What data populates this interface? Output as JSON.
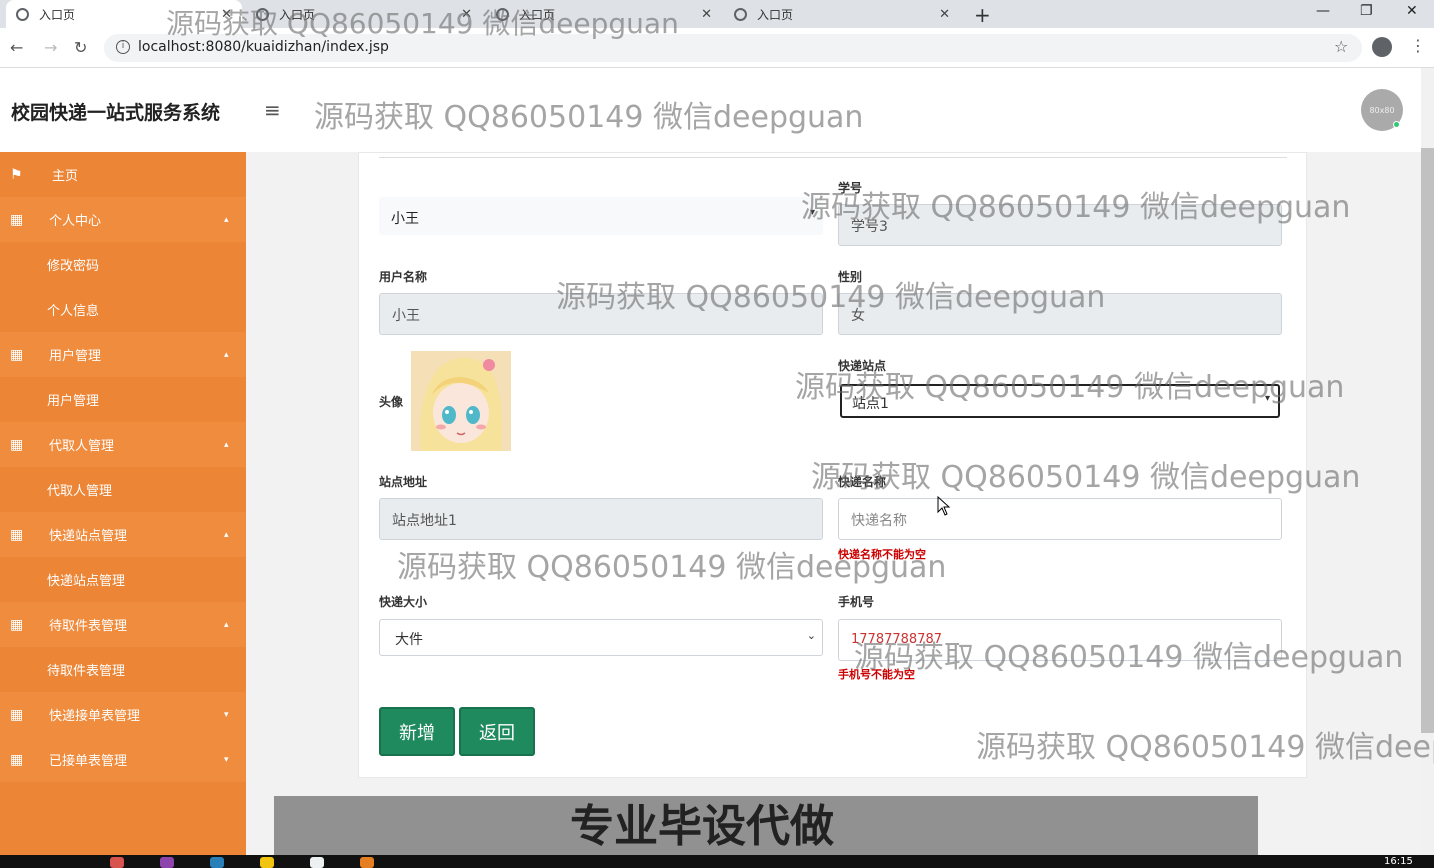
{
  "browser": {
    "tabs": [
      {
        "title": "入口页",
        "active": true
      },
      {
        "title": "入口页",
        "active": false
      },
      {
        "title": "入口页",
        "active": false
      },
      {
        "title": "入口页",
        "active": false
      }
    ],
    "url": "localhost:8080/kuaidizhan/index.jsp"
  },
  "header": {
    "title": "校园快递一站式服务系统",
    "avatar_text": "80x80"
  },
  "sidebar": {
    "items": [
      {
        "label": "主页",
        "type": "root",
        "icon": "flag-icon"
      },
      {
        "label": "个人中心",
        "type": "parent",
        "icon": "grid-icon",
        "caret": "up"
      },
      {
        "label": "修改密码",
        "type": "child"
      },
      {
        "label": "个人信息",
        "type": "child"
      },
      {
        "label": "用户管理",
        "type": "parent",
        "icon": "grid-icon",
        "caret": "up"
      },
      {
        "label": "用户管理",
        "type": "child"
      },
      {
        "label": "代取人管理",
        "type": "parent",
        "icon": "grid-icon",
        "caret": "up"
      },
      {
        "label": "代取人管理",
        "type": "child"
      },
      {
        "label": "快递站点管理",
        "type": "parent",
        "icon": "grid-icon",
        "caret": "up"
      },
      {
        "label": "快递站点管理",
        "type": "child"
      },
      {
        "label": "待取件表管理",
        "type": "parent",
        "icon": "grid-icon",
        "caret": "up"
      },
      {
        "label": "待取件表管理",
        "type": "child"
      },
      {
        "label": "快递接单表管理",
        "type": "parent",
        "icon": "grid-icon",
        "caret": "down"
      },
      {
        "label": "已接单表管理",
        "type": "parent",
        "icon": "grid-icon",
        "caret": "down"
      }
    ]
  },
  "form": {
    "user_select_value": "小王",
    "student_no_label": "学号",
    "student_no_value": "学号3",
    "username_label": "用户名称",
    "username_value": "小王",
    "gender_label": "性别",
    "gender_value": "女",
    "avatar_label": "头像",
    "station_label": "快递站点",
    "station_value": "站点1",
    "address_label": "站点地址",
    "address_value": "站点地址1",
    "express_name_label": "快递名称",
    "express_name_placeholder": "快递名称",
    "express_name_error": "快递名称不能为空",
    "size_label": "快递大小",
    "size_value": "大件",
    "phone_label": "手机号",
    "phone_value": "17787788787",
    "phone_error": "手机号不能为空",
    "add_button": "新增",
    "back_button": "返回"
  },
  "watermark": "源码获取 QQ86050149 微信deepguan",
  "overlay_text": "专业毕设代做",
  "taskbar_time": "16:15",
  "colors": {
    "sidebar": "#ec8536",
    "button": "#1e8a5e",
    "error": "#cc0000"
  }
}
